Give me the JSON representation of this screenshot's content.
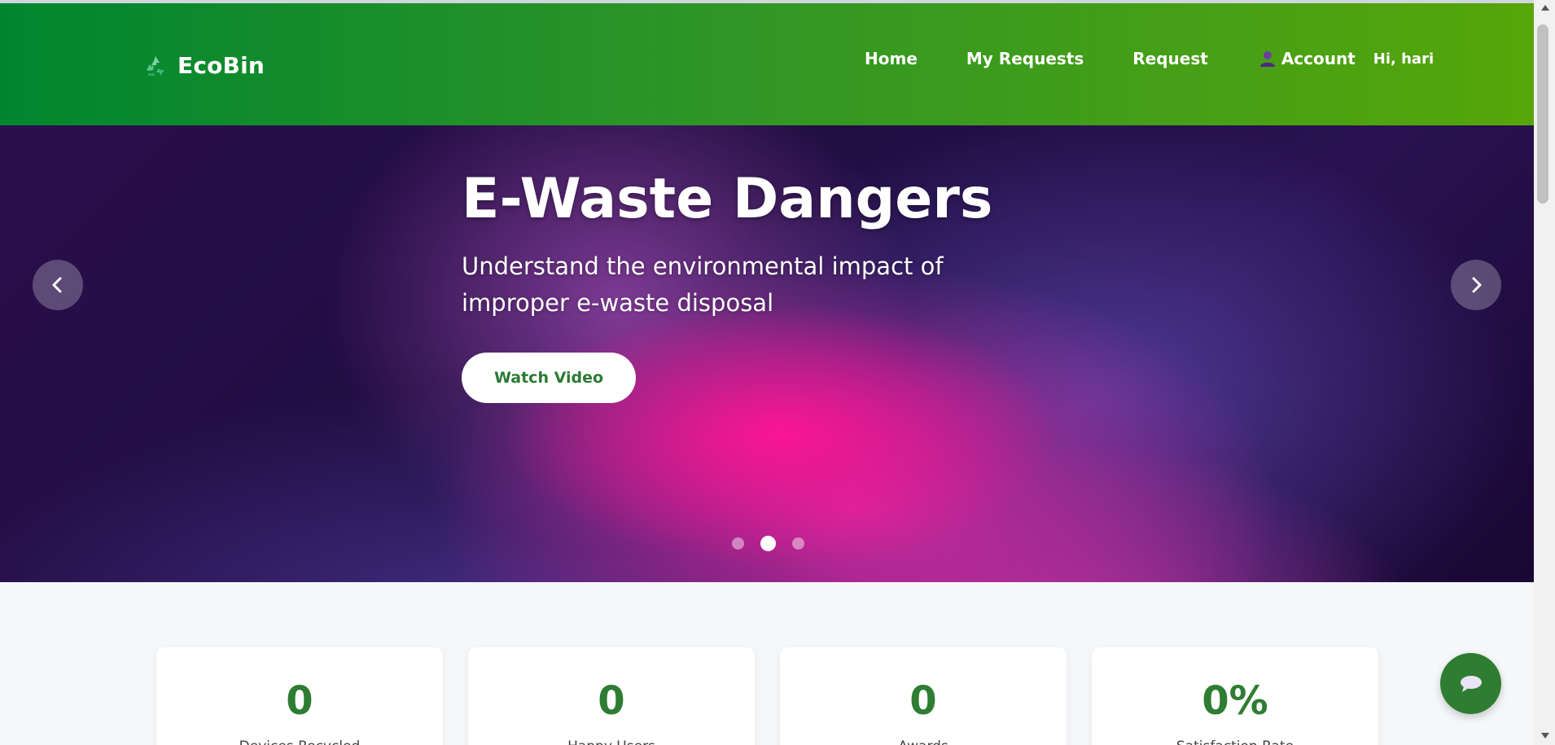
{
  "brand": {
    "name": "EcoBin",
    "icon": "recycle-icon"
  },
  "nav": {
    "home": "Home",
    "my_requests": "My Requests",
    "request": "Request",
    "account": "Account",
    "account_icon": "user-icon",
    "greeting": "Hi, hari"
  },
  "hero": {
    "title": "E-Waste Dangers",
    "subtitle": "Understand the environmental impact of improper e-waste disposal",
    "button": "Watch Video",
    "prev_icon": "chevron-left-icon",
    "next_icon": "chevron-right-icon",
    "slide_count": 3,
    "active_slide": 2
  },
  "stats": [
    {
      "value": "0",
      "label": "Devices Recycled"
    },
    {
      "value": "0",
      "label": "Happy Users"
    },
    {
      "value": "0",
      "label": "Awards"
    },
    {
      "value": "0%",
      "label": "Satisfaction Rate"
    }
  ],
  "chat": {
    "icon": "chat-icon"
  },
  "colors": {
    "header_start": "#00852f",
    "header_end": "#56a60a",
    "accent_green": "#2e7d32",
    "hero_dark": "#1f0d40",
    "hero_pink": "#ff1496"
  }
}
